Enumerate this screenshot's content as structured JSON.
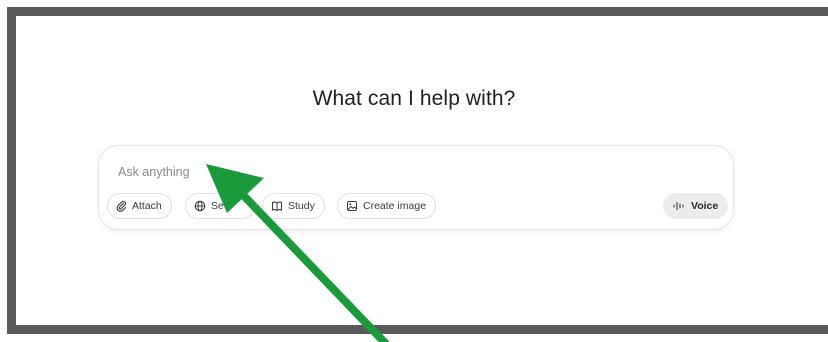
{
  "main": {
    "heading": "What can I help with?"
  },
  "composer": {
    "placeholder": "Ask anything",
    "value": "",
    "buttons": {
      "attach": "Attach",
      "search": "Se",
      "study": "Study",
      "create_image": "Create image",
      "voice": "Voice"
    }
  },
  "icons": {
    "attach": "paperclip-icon",
    "search": "globe-icon",
    "study": "book-icon",
    "create_image": "image-icon",
    "voice": "waveform-icon"
  },
  "colors": {
    "frame_border": "#5a5a5a",
    "annotation_arrow": "#1a9a3a",
    "voice_pill": "#ececec"
  }
}
